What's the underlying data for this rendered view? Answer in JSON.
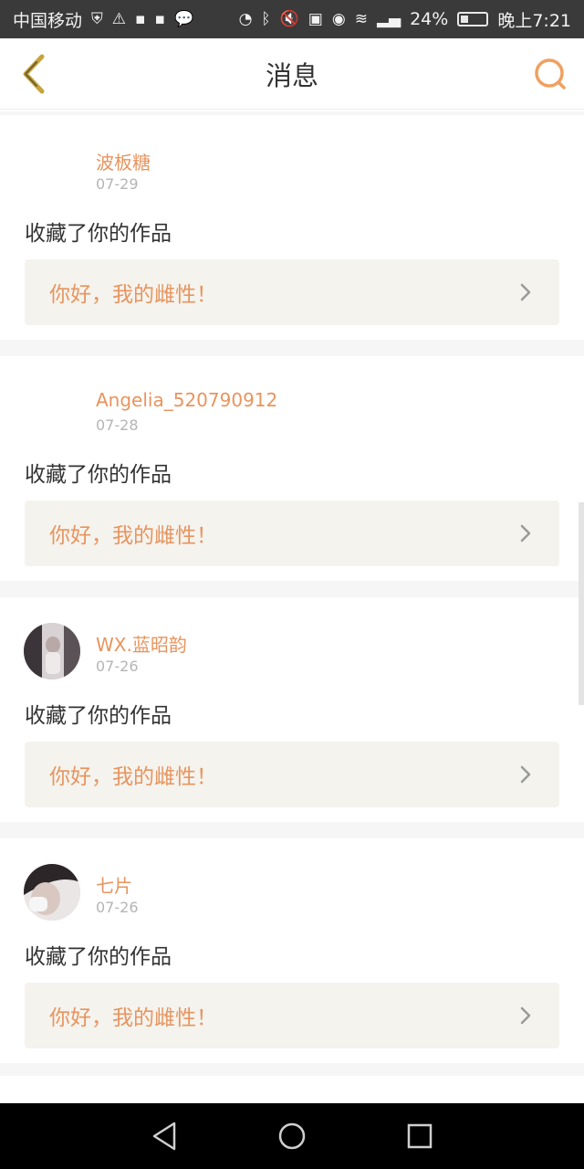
{
  "status_bar": {
    "carrier": "中国移动",
    "battery": "24%",
    "time": "晚上7:21",
    "icons_left": [
      "shield-icon",
      "warning-icon",
      "app-icon",
      "app-icon",
      "chat-bubble-icon"
    ],
    "icons_right": [
      "data-saver-icon",
      "bluetooth-icon",
      "mute-icon",
      "hd-icon",
      "eye-icon",
      "wifi-icon",
      "signal-icon"
    ]
  },
  "header": {
    "title": "消息"
  },
  "messages": [
    {
      "username": "波板糖",
      "date": "07-29",
      "action": "收藏了你的作品",
      "quote": "你好，我的雌性！",
      "has_avatar": false
    },
    {
      "username": "Angelia_520790912",
      "date": "07-28",
      "action": "收藏了你的作品",
      "quote": "你好，我的雌性！",
      "has_avatar": false
    },
    {
      "username": "WX.蓝昭韵",
      "date": "07-26",
      "action": "收藏了你的作品",
      "quote": "你好，我的雌性！",
      "has_avatar": true
    },
    {
      "username": "七片",
      "date": "07-26",
      "action": "收藏了你的作品",
      "quote": "你好，我的雌性！",
      "has_avatar": true
    }
  ],
  "colors": {
    "accent": "#e8945e",
    "back_icon": "#c7a43a",
    "quote_bg": "#f4f3ee"
  }
}
